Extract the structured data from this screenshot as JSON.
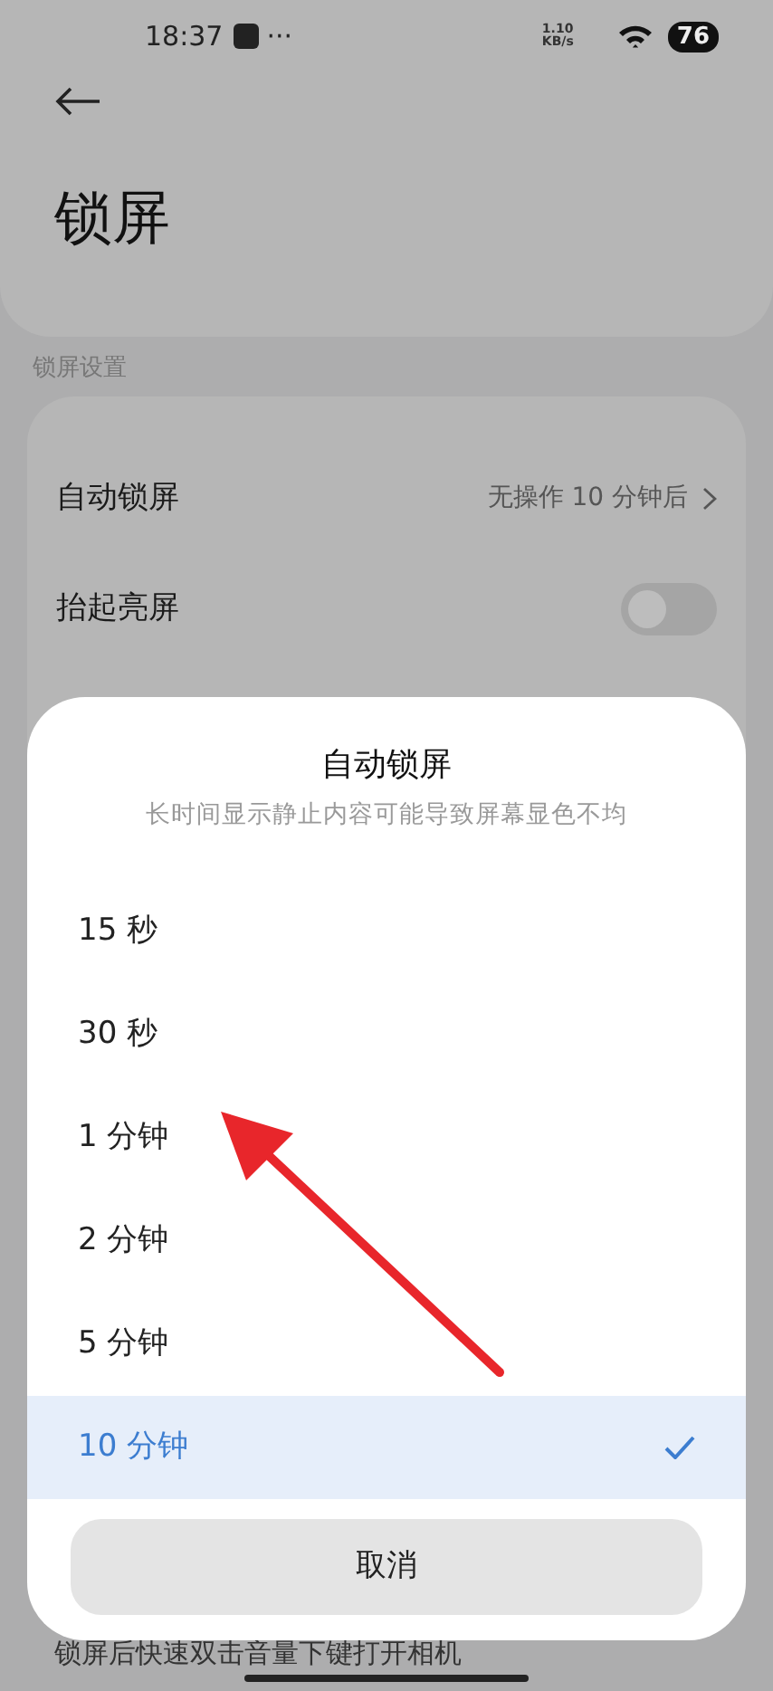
{
  "status_bar": {
    "time": "18:37",
    "more": "···",
    "net_speed": [
      "1.10",
      "KB/s"
    ],
    "battery": "76"
  },
  "page": {
    "title": "锁屏",
    "section_label": "锁屏设置",
    "rows": [
      {
        "kind": "link",
        "label": "自动锁屏",
        "value": "无操作 10 分钟后"
      },
      {
        "kind": "toggle",
        "label": "抬起亮屏",
        "on": false
      }
    ],
    "footer_text": "锁屏后快速双击音量下键打开相机"
  },
  "sheet": {
    "title": "自动锁屏",
    "subtitle": "长时间显示静止内容可能导致屏幕显色不均",
    "options": [
      {
        "label": "15 秒",
        "selected": false
      },
      {
        "label": "30 秒",
        "selected": false
      },
      {
        "label": "1 分钟",
        "selected": false
      },
      {
        "label": "2 分钟",
        "selected": false
      },
      {
        "label": "5 分钟",
        "selected": false
      },
      {
        "label": "10 分钟",
        "selected": true
      }
    ],
    "cancel": "取消"
  }
}
